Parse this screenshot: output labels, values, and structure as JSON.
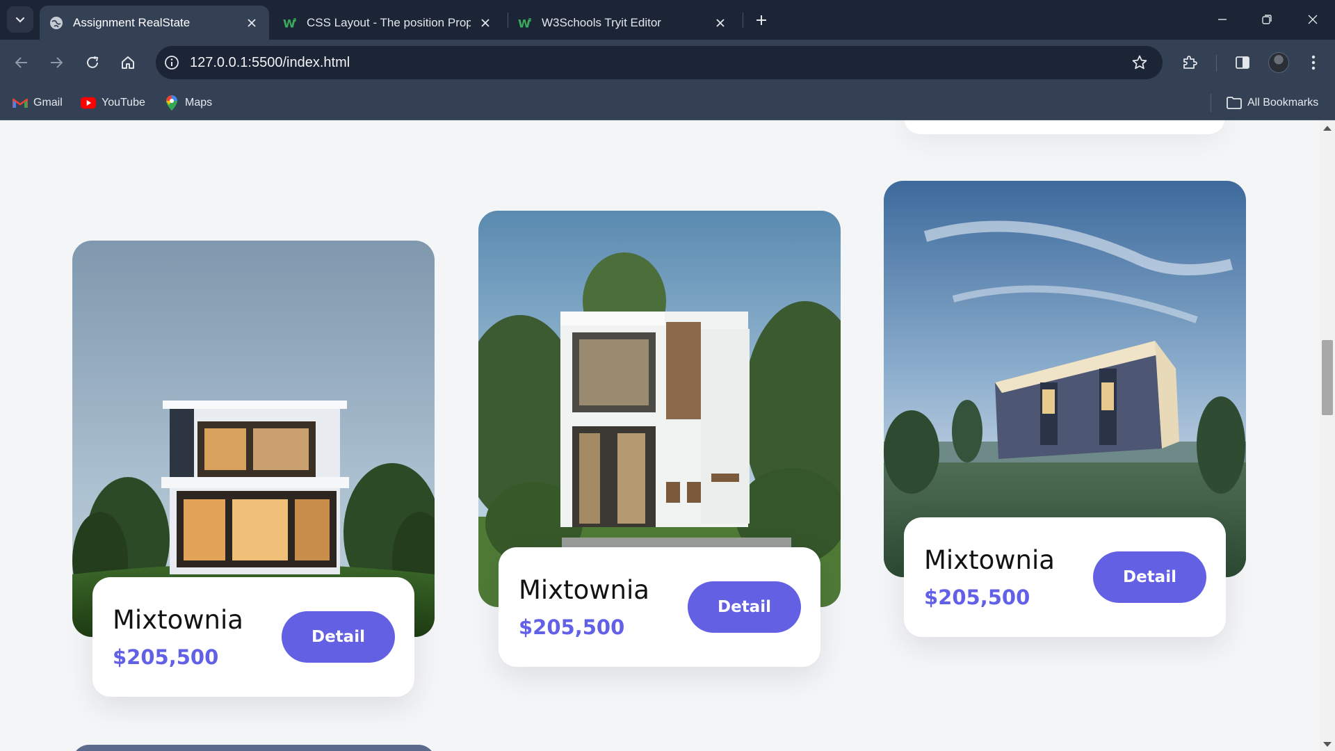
{
  "browser": {
    "tabs": [
      {
        "title": "Assignment RealState",
        "active": true,
        "favicon": "globe-icon"
      },
      {
        "title": "CSS Layout - The position Property",
        "active": false,
        "favicon": "w3schools-icon"
      },
      {
        "title": "W3Schools Tryit Editor",
        "active": false,
        "favicon": "w3schools-icon"
      }
    ],
    "url": "127.0.0.1:5500/index.html",
    "bookmarks": [
      {
        "label": "Gmail",
        "icon": "gmail-icon"
      },
      {
        "label": "YouTube",
        "icon": "youtube-icon"
      },
      {
        "label": "Maps",
        "icon": "maps-icon"
      }
    ],
    "all_bookmarks_label": "All Bookmarks"
  },
  "colors": {
    "accent": "#6360e4",
    "chrome_dark": "#1b2536",
    "chrome_mid": "#344155",
    "page_bg": "#f4f5f7"
  },
  "properties": [
    {
      "name": "Mixtownia",
      "price": "$205,500",
      "button": "Detail"
    },
    {
      "name": "Mixtownia",
      "price": "$205,500",
      "button": "Detail"
    },
    {
      "name": "Mixtownia",
      "price": "$205,500",
      "button": "Detail"
    }
  ]
}
